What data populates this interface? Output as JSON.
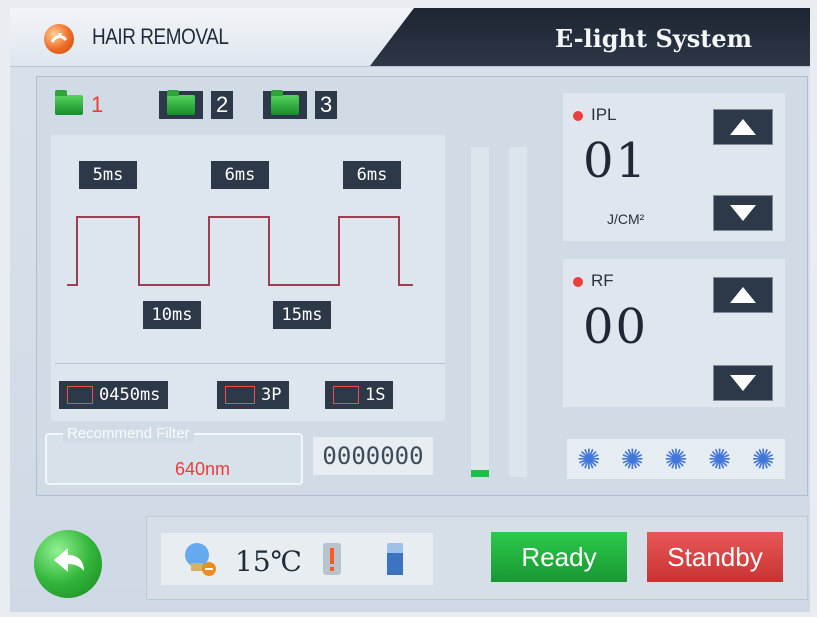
{
  "header": {
    "app_title": "HAIR REMOVAL",
    "system_title": "E-light System"
  },
  "tabs": [
    {
      "label": "1",
      "active": true
    },
    {
      "label": "2",
      "active": false
    },
    {
      "label": "3",
      "active": false
    }
  ],
  "pulse": {
    "widths": [
      "5ms",
      "6ms",
      "6ms"
    ],
    "delays": [
      "10ms",
      "15ms"
    ]
  },
  "settings": {
    "pulse_time": "0450ms",
    "pulse_count": "3P",
    "interval": "1S"
  },
  "filter": {
    "title": "Recommend Filter",
    "value": "640nm"
  },
  "counter": "0000000",
  "ipl": {
    "label": "IPL",
    "value": "01",
    "unit": "J/CM²"
  },
  "rf": {
    "label": "RF",
    "value": "00"
  },
  "energy_levels": {
    "left": 0.02,
    "right": 0.0
  },
  "cooling_icons": [
    "snowflake-icon",
    "snowflake-icon",
    "snowflake-icon",
    "snowflake-icon",
    "snowflake-icon"
  ],
  "status": {
    "temperature": "15℃"
  },
  "actions": {
    "ready": "Ready",
    "standby": "Standby"
  }
}
